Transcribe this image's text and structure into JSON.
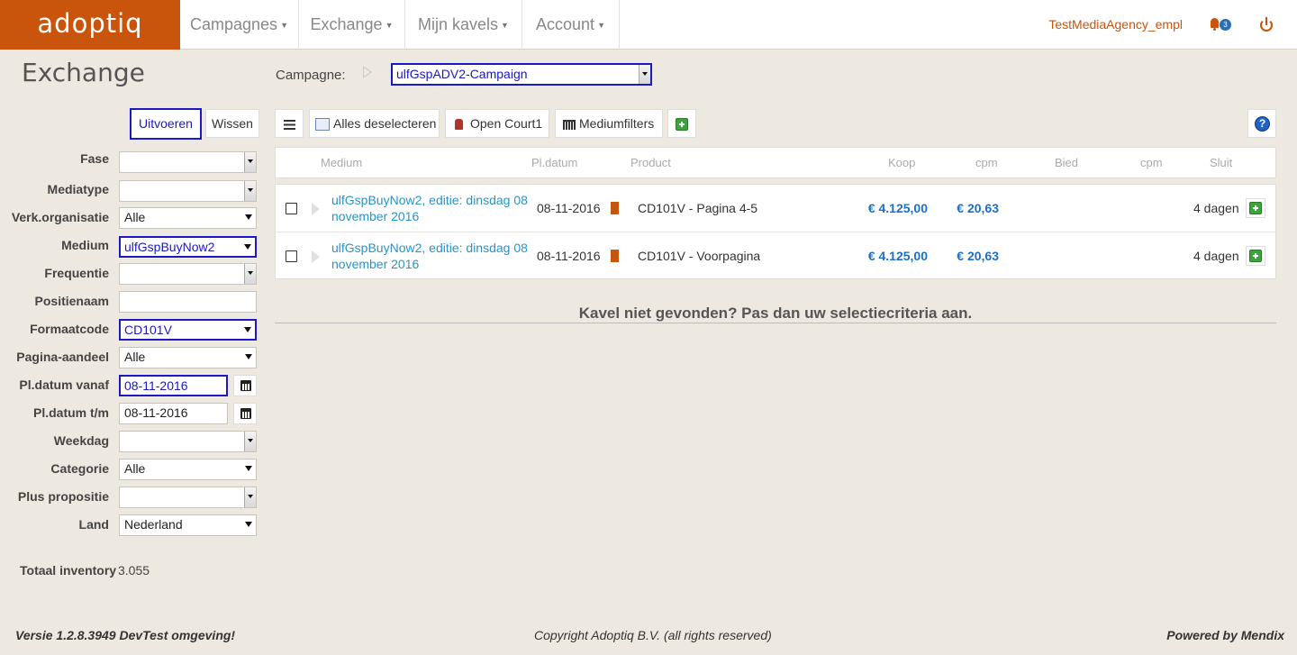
{
  "app": {
    "logo": "adoptiq"
  },
  "nav": {
    "items": [
      {
        "label": "Campagnes"
      },
      {
        "label": "Exchange"
      },
      {
        "label": "Mijn kavels"
      },
      {
        "label": "Account"
      }
    ],
    "user": "TestMediaAgency_empl",
    "notification_count": "3"
  },
  "page": {
    "title": "Exchange"
  },
  "campaign": {
    "label": "Campagne:",
    "selected": "ulfGspADV2-Campaign"
  },
  "filters": {
    "run_label": "Uitvoeren",
    "clear_label": "Wissen",
    "fields": {
      "fase": {
        "label": "Fase",
        "value": ""
      },
      "mediatype": {
        "label": "Mediatype",
        "value": ""
      },
      "verk_org": {
        "label": "Verk.organisatie",
        "value": "Alle"
      },
      "medium": {
        "label": "Medium",
        "value": "ulfGspBuyNow2"
      },
      "frequentie": {
        "label": "Frequentie",
        "value": ""
      },
      "positienaam": {
        "label": "Positienaam",
        "value": ""
      },
      "formaatcode": {
        "label": "Formaatcode",
        "value": "CD101V"
      },
      "pagina_aandeel": {
        "label": "Pagina-aandeel",
        "value": "Alle"
      },
      "pl_datum_vanaf": {
        "label": "Pl.datum vanaf",
        "value": "08-11-2016"
      },
      "pl_datum_tm": {
        "label": "Pl.datum t/m",
        "value": "08-11-2016"
      },
      "weekdag": {
        "label": "Weekdag",
        "value": ""
      },
      "categorie": {
        "label": "Categorie",
        "value": "Alle"
      },
      "plus_propositie": {
        "label": "Plus propositie",
        "value": ""
      },
      "land": {
        "label": "Land",
        "value": "Nederland"
      }
    },
    "total_label": "Totaal inventory",
    "total_value": "3.055"
  },
  "toolbar": {
    "deselect_label": "Alles deselecteren",
    "open_court_label": "Open Court1",
    "mediumfilters_label": "Mediumfilters",
    "help_label": "?"
  },
  "table": {
    "headers": {
      "medium": "Medium",
      "pldatum": "Pl.datum",
      "product": "Product",
      "koop": "Koop",
      "cpm1": "cpm",
      "bied": "Bied",
      "cpm2": "cpm",
      "sluit": "Sluit"
    },
    "rows": [
      {
        "medium": "ulfGspBuyNow2, editie: dinsdag 08 november 2016",
        "pldatum": "08-11-2016",
        "product": "CD101V - Pagina 4-5",
        "koop": "€ 4.125,00",
        "cpm": "€ 20,63",
        "sluit": "4 dagen"
      },
      {
        "medium": "ulfGspBuyNow2, editie: dinsdag 08 november 2016",
        "pldatum": "08-11-2016",
        "product": "CD101V - Voorpagina",
        "koop": "€ 4.125,00",
        "cpm": "€ 20,63",
        "sluit": "4 dagen"
      }
    ],
    "not_found": "Kavel niet gevonden? Pas dan uw selectiecriteria aan."
  },
  "footer": {
    "version": "Versie 1.2.8.3949 DevTest omgeving!",
    "copyright": "Copyright Adoptiq B.V. (all rights reserved)",
    "powered": "Powered by Mendix"
  },
  "colors": {
    "brand": "#c9540b",
    "focus": "#1a19c4",
    "link": "#2a93c9",
    "price": "#1b6fc9"
  }
}
